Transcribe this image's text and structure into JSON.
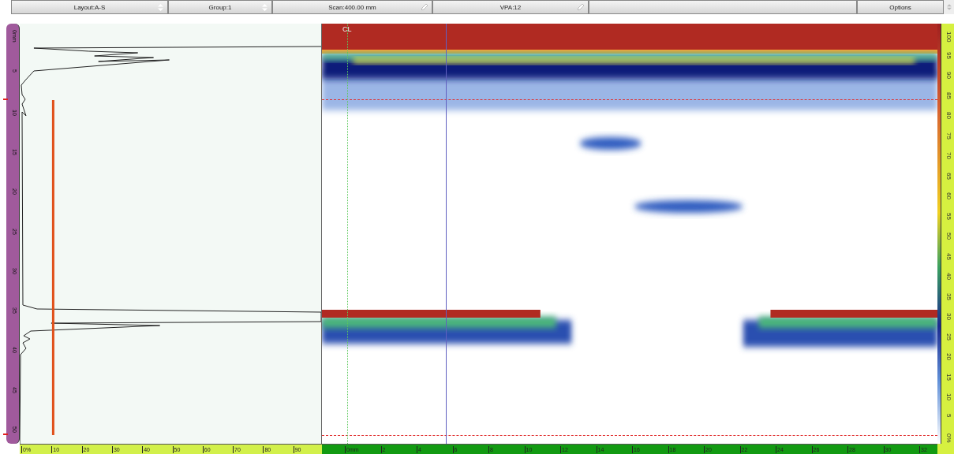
{
  "toolbar": [
    {
      "label": "Layout:A-S",
      "kind": "dropdown"
    },
    {
      "label": "Group:1",
      "kind": "dropdown"
    },
    {
      "label": "Scan:400.00 mm",
      "kind": "edit"
    },
    {
      "label": "VPA:12",
      "kind": "edit"
    }
  ],
  "options": {
    "label": "Options"
  },
  "depth_ruler": {
    "labels": [
      "0mm",
      "5",
      "10",
      "15",
      "20",
      "25",
      "30",
      "35",
      "40",
      "45",
      "50"
    ]
  },
  "amplitude_ruler": {
    "labels": [
      "0%",
      "10",
      "20",
      "30",
      "40",
      "50",
      "60",
      "70",
      "80",
      "90"
    ]
  },
  "s_scan": {
    "cursor_label": "CL"
  },
  "index_ruler": {
    "labels": [
      "0mm",
      "2",
      "4",
      "6",
      "8",
      "10",
      "12",
      "14",
      "16",
      "18",
      "20",
      "22",
      "24",
      "26",
      "28",
      "30",
      "32"
    ]
  },
  "color_ruler": {
    "labels": [
      "100",
      "95",
      "90",
      "85",
      "80",
      "75",
      "70",
      "65",
      "60",
      "55",
      "50",
      "45",
      "40",
      "35",
      "30",
      "25",
      "20",
      "15",
      "10",
      "5",
      "0%"
    ]
  }
}
